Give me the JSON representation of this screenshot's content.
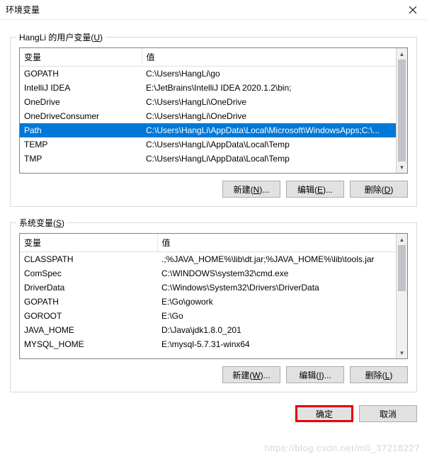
{
  "window": {
    "title": "环境变量"
  },
  "user_vars": {
    "legend_prefix": "HangLi 的用户变量(",
    "legend_accel": "U",
    "legend_suffix": ")",
    "col_var": "变量",
    "col_val": "值",
    "rows": [
      {
        "var": "GOPATH",
        "val": "C:\\Users\\HangLi\\go",
        "selected": false
      },
      {
        "var": "IntelliJ IDEA",
        "val": "E:\\JetBrains\\IntelliJ IDEA 2020.1.2\\bin;",
        "selected": false
      },
      {
        "var": "OneDrive",
        "val": "C:\\Users\\HangLi\\OneDrive",
        "selected": false
      },
      {
        "var": "OneDriveConsumer",
        "val": "C:\\Users\\HangLi\\OneDrive",
        "selected": false
      },
      {
        "var": "Path",
        "val": "C:\\Users\\HangLi\\AppData\\Local\\Microsoft\\WindowsApps;C:\\...",
        "selected": true
      },
      {
        "var": "TEMP",
        "val": "C:\\Users\\HangLi\\AppData\\Local\\Temp",
        "selected": false
      },
      {
        "var": "TMP",
        "val": "C:\\Users\\HangLi\\AppData\\Local\\Temp",
        "selected": false
      }
    ],
    "btn_new": "新建(N)...",
    "btn_new_accel": "N",
    "btn_edit": "编辑(E)...",
    "btn_edit_accel": "E",
    "btn_del": "删除(D)",
    "btn_del_accel": "D"
  },
  "sys_vars": {
    "legend_prefix": "系统变量(",
    "legend_accel": "S",
    "legend_suffix": ")",
    "col_var": "变量",
    "col_val": "值",
    "rows": [
      {
        "var": "CLASSPATH",
        "val": ".;%JAVA_HOME%\\lib\\dt.jar;%JAVA_HOME%\\lib\\tools.jar"
      },
      {
        "var": "ComSpec",
        "val": "C:\\WINDOWS\\system32\\cmd.exe"
      },
      {
        "var": "DriverData",
        "val": "C:\\Windows\\System32\\Drivers\\DriverData"
      },
      {
        "var": "GOPATH",
        "val": "E:\\Go\\gowork"
      },
      {
        "var": "GOROOT",
        "val": "E:\\Go"
      },
      {
        "var": "JAVA_HOME",
        "val": "D:\\Java\\jdk1.8.0_201"
      },
      {
        "var": "MYSQL_HOME",
        "val": "E:\\mysql-5.7.31-winx64"
      }
    ],
    "btn_new": "新建(W)...",
    "btn_new_accel": "W",
    "btn_edit": "编辑(I)...",
    "btn_edit_accel": "I",
    "btn_del": "删除(L)",
    "btn_del_accel": "L"
  },
  "dialog": {
    "ok": "确定",
    "cancel": "取消"
  },
  "watermark": "https://blog.csdn.net/m0_37218227"
}
